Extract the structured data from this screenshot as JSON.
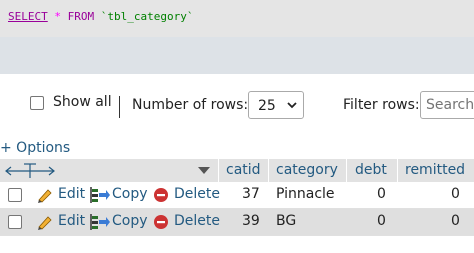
{
  "sql": {
    "select": "SELECT",
    "star": "*",
    "from": "FROM",
    "table": "`tbl_category`"
  },
  "controls": {
    "show_all": "Show all",
    "num_rows_label": "Number of rows:",
    "rows_value": "25",
    "filter_label": "Filter rows:",
    "filter_placeholder": "Search"
  },
  "options_label": "+ Options",
  "table": {
    "headers": [
      "catid",
      "category",
      "debt",
      "remitted"
    ],
    "actions": {
      "edit": "Edit",
      "copy": "Copy",
      "delete": "Delete"
    },
    "rows": [
      {
        "catid": "37",
        "category": "Pinnacle",
        "debt": "0",
        "remitted": "0"
      },
      {
        "catid": "39",
        "category": "BG",
        "debt": "0",
        "remitted": "0"
      }
    ]
  },
  "colors": {
    "link": "#235a81",
    "header_bg": "#e2e2e2",
    "band_bg": "#dde2e7",
    "delete_red": "#cc3333"
  },
  "icons": [
    "pencil-icon",
    "copy-icon",
    "delete-icon",
    "sort-caret-icon",
    "select-caret-icon",
    "column-arrows-icon"
  ]
}
